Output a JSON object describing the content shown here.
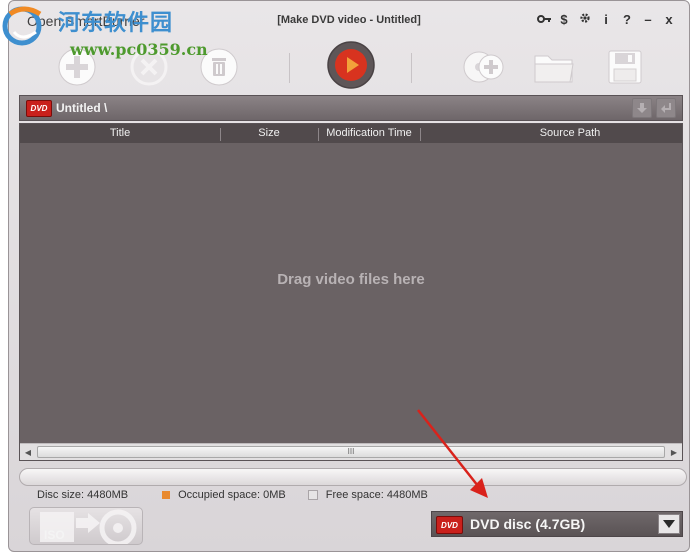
{
  "watermark": {
    "cn_text": "河东软件园",
    "url": "www.pc0359.cn"
  },
  "titlebar": {
    "app_name": "Open SmartBurner",
    "window_title": "[Make DVD video - Untitled]",
    "controls": {
      "key": "",
      "dollar": "$",
      "settings": "",
      "info": "i",
      "help": "?",
      "minimize": "–",
      "close": "x"
    }
  },
  "toolbar": {
    "buttons": [
      {
        "icon": "add-icon"
      },
      {
        "icon": "remove-icon"
      },
      {
        "icon": "trash-icon"
      },
      {
        "icon": "burn-icon"
      },
      {
        "icon": "add-disc-icon"
      },
      {
        "icon": "folder-icon"
      },
      {
        "icon": "save-icon"
      }
    ]
  },
  "breadcrumb": {
    "badge": "DVD",
    "path": "Untitled \\",
    "buttons": [
      "down-arrow-icon",
      "enter-icon"
    ]
  },
  "table": {
    "columns": [
      "Title",
      "Size",
      "Modification Time",
      "Source Path"
    ],
    "rows": [],
    "empty_hint": "Drag video files here",
    "scroll_grip": "III"
  },
  "progress": {
    "fraction": 0
  },
  "stats": {
    "disc_size": "Disc size: 4480MB",
    "occupied": "Occupied space: 0MB",
    "free": "Free space: 4480MB",
    "occupied_color": "#e8892e",
    "free_color": "#e6e4e5"
  },
  "footer": {
    "iso_label": "ISO",
    "disc_badge": "DVD",
    "disc_type": "DVD disc (4.7GB)"
  },
  "colors": {
    "list_bg": "#6a6264",
    "header_bg": "#514a4c",
    "burn_red": "#d8331f",
    "annotation": "#d9221b"
  }
}
